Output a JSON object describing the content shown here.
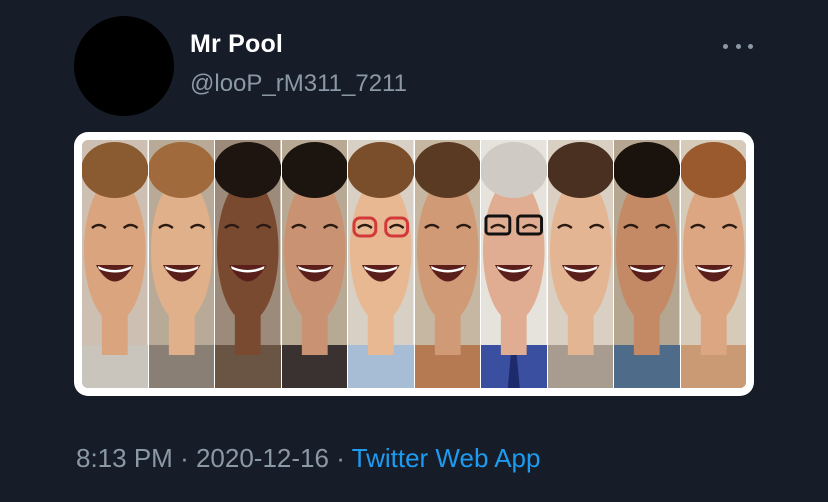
{
  "tweet": {
    "display_name": "Mr Pool",
    "handle": "@looP_rM311_7211",
    "time": "8:13 PM",
    "separator": "·",
    "date": "2020-12-16",
    "source": "Twitter Web App"
  },
  "icons": {
    "more": "more-horizontal-icon"
  },
  "media": {
    "description_icon": "image-collage",
    "strips": [
      {
        "skin": "#d9a47e",
        "hair": "#8a5a30",
        "bg": "#cdbfb1",
        "shirt": "#c9c5bd"
      },
      {
        "skin": "#e0b08a",
        "hair": "#a06a3c",
        "bg": "#b9aa97",
        "shirt": "#8a7f74"
      },
      {
        "skin": "#7a4a30",
        "hair": "#1e1410",
        "bg": "#9c8b7a",
        "shirt": "#6a5444"
      },
      {
        "skin": "#c99272",
        "hair": "#1c140e",
        "bg": "#b8a995",
        "shirt": "#3a3230"
      },
      {
        "skin": "#e8b893",
        "hair": "#7a4e2a",
        "bg": "#d8d0c4",
        "shirt": "#a7bdd6"
      },
      {
        "skin": "#d19a76",
        "hair": "#5a3a22",
        "bg": "#c6b7a2",
        "shirt": "#b57a52"
      },
      {
        "skin": "#e0ad92",
        "hair": "#cfcac4",
        "bg": "#e6e2dc",
        "shirt": "#3b4fa0"
      },
      {
        "skin": "#e3b593",
        "hair": "#4a3020",
        "bg": "#d9cfc2",
        "shirt": "#a89c90"
      },
      {
        "skin": "#c48a66",
        "hair": "#1a120c",
        "bg": "#b5a692",
        "shirt": "#4e6b8a"
      },
      {
        "skin": "#dca683",
        "hair": "#9a5a2e",
        "bg": "#d6cab9",
        "shirt": "#c99a74"
      }
    ]
  }
}
